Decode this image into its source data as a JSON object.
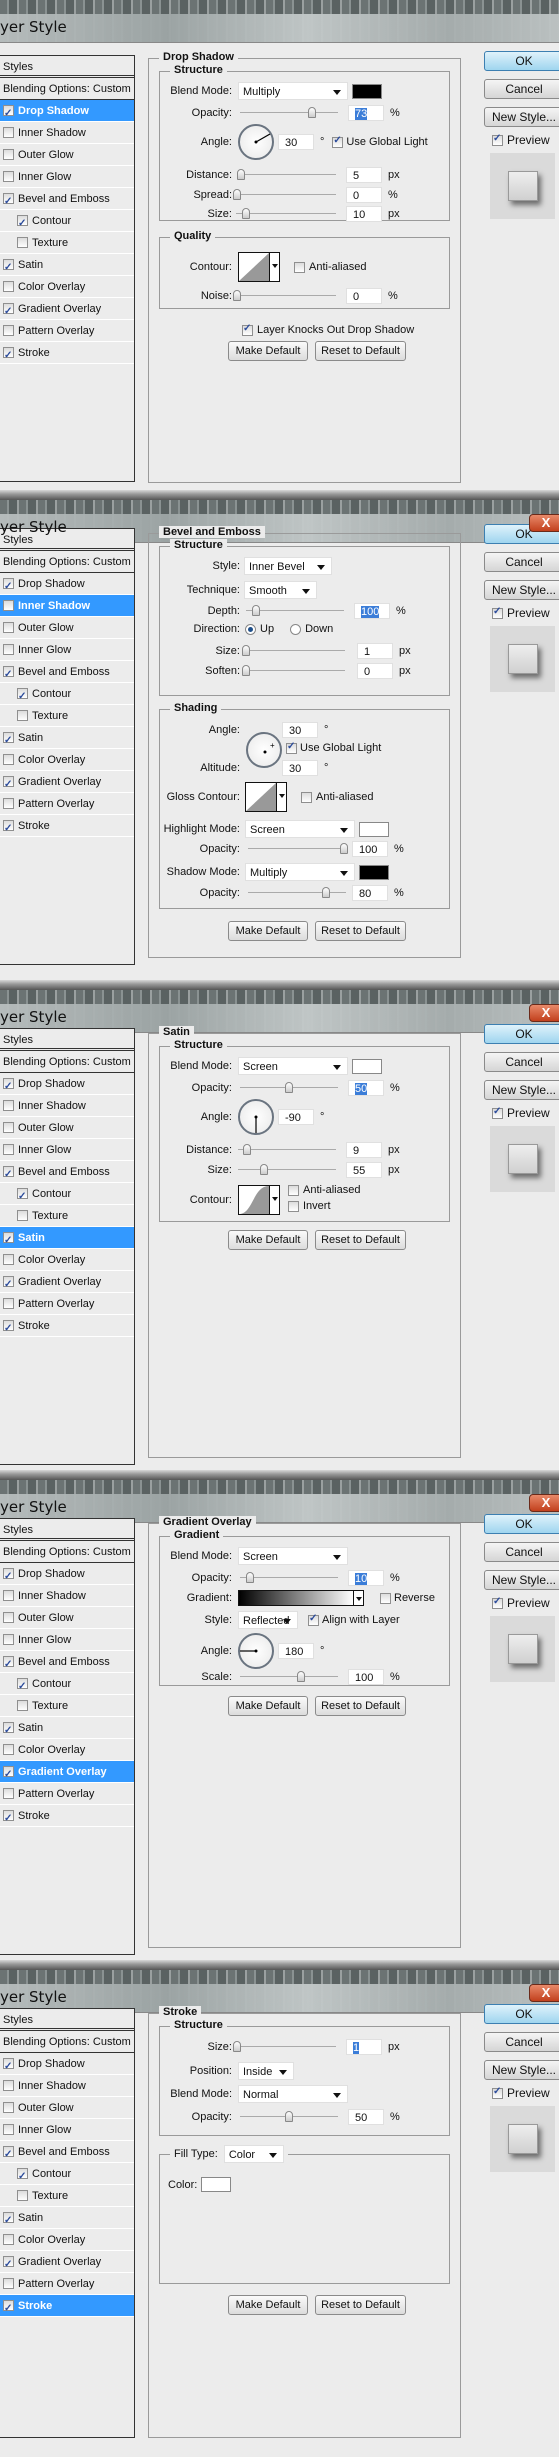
{
  "window": {
    "title": "yer Style",
    "close_label": "X"
  },
  "sidebar": {
    "header": "Styles",
    "blending_options": "Blending Options: Custom",
    "items": [
      {
        "label": "Drop Shadow",
        "checked": true,
        "sub": false
      },
      {
        "label": "Inner Shadow",
        "checked": false,
        "sub": false
      },
      {
        "label": "Outer Glow",
        "checked": false,
        "sub": false
      },
      {
        "label": "Inner Glow",
        "checked": false,
        "sub": false
      },
      {
        "label": "Bevel and Emboss",
        "checked": true,
        "sub": false
      },
      {
        "label": "Contour",
        "checked": true,
        "sub": true
      },
      {
        "label": "Texture",
        "checked": false,
        "sub": true
      },
      {
        "label": "Satin",
        "checked": true,
        "sub": false
      },
      {
        "label": "Color Overlay",
        "checked": false,
        "sub": false
      },
      {
        "label": "Gradient Overlay",
        "checked": true,
        "sub": false
      },
      {
        "label": "Pattern Overlay",
        "checked": false,
        "sub": false
      },
      {
        "label": "Stroke",
        "checked": true,
        "sub": false
      }
    ]
  },
  "right_buttons": {
    "ok": "OK",
    "cancel": "Cancel",
    "new_style": "New Style...",
    "preview": "Preview",
    "preview_checked": true
  },
  "common": {
    "make_default": "Make Default",
    "reset_default": "Reset to Default",
    "px": "px",
    "pct": "%",
    "deg": "°"
  },
  "drop_shadow": {
    "title": "Drop Shadow",
    "structure": "Structure",
    "blend_mode_label": "Blend Mode:",
    "blend_mode": "Multiply",
    "color": "#000000",
    "opacity_label": "Opacity:",
    "opacity": "73",
    "angle_label": "Angle:",
    "angle": "30",
    "use_global_light": "Use Global Light",
    "distance_label": "Distance:",
    "distance": "5",
    "spread_label": "Spread:",
    "spread": "0",
    "size_label": "Size:",
    "size": "10",
    "quality": "Quality",
    "contour_label": "Contour:",
    "anti_aliased": "Anti-aliased",
    "noise_label": "Noise:",
    "noise": "0",
    "knockout": "Layer Knocks Out Drop Shadow"
  },
  "bevel": {
    "title": "Bevel and Emboss",
    "structure": "Structure",
    "style_label": "Style:",
    "style": "Inner Bevel",
    "technique_label": "Technique:",
    "technique": "Smooth",
    "depth_label": "Depth:",
    "depth": "100",
    "direction_label": "Direction:",
    "up": "Up",
    "down": "Down",
    "size_label": "Size:",
    "size": "1",
    "soften_label": "Soften:",
    "soften": "0",
    "shading": "Shading",
    "angle_label": "Angle:",
    "angle": "30",
    "use_global_light": "Use Global Light",
    "altitude_label": "Altitude:",
    "altitude": "30",
    "gloss_contour_label": "Gloss Contour:",
    "anti_aliased": "Anti-aliased",
    "highlight_mode_label": "Highlight Mode:",
    "highlight_mode": "Screen",
    "highlight_color": "#ffffff",
    "highlight_opacity_label": "Opacity:",
    "highlight_opacity": "100",
    "shadow_mode_label": "Shadow Mode:",
    "shadow_mode": "Multiply",
    "shadow_color": "#000000",
    "shadow_opacity_label": "Opacity:",
    "shadow_opacity": "80"
  },
  "satin": {
    "title": "Satin",
    "structure": "Structure",
    "blend_mode_label": "Blend Mode:",
    "blend_mode": "Screen",
    "color": "#ffffff",
    "opacity_label": "Opacity:",
    "opacity": "50",
    "angle_label": "Angle:",
    "angle": "-90",
    "distance_label": "Distance:",
    "distance": "9",
    "size_label": "Size:",
    "size": "55",
    "contour_label": "Contour:",
    "anti_aliased": "Anti-aliased",
    "invert": "Invert"
  },
  "gradient_overlay": {
    "title": "Gradient Overlay",
    "group": "Gradient",
    "blend_mode_label": "Blend Mode:",
    "blend_mode": "Screen",
    "opacity_label": "Opacity:",
    "opacity": "10",
    "gradient_label": "Gradient:",
    "reverse": "Reverse",
    "style_label": "Style:",
    "style": "Reflected",
    "align_with_layer": "Align with Layer",
    "angle_label": "Angle:",
    "angle": "180",
    "scale_label": "Scale:",
    "scale": "100"
  },
  "stroke": {
    "title": "Stroke",
    "structure": "Structure",
    "size_label": "Size:",
    "size": "1",
    "position_label": "Position:",
    "position": "Inside",
    "blend_mode_label": "Blend Mode:",
    "blend_mode": "Normal",
    "opacity_label": "Opacity:",
    "opacity": "50",
    "fill_type_label": "Fill Type:",
    "fill_type": "Color",
    "color_label": "Color:",
    "color": "#ffffff"
  }
}
